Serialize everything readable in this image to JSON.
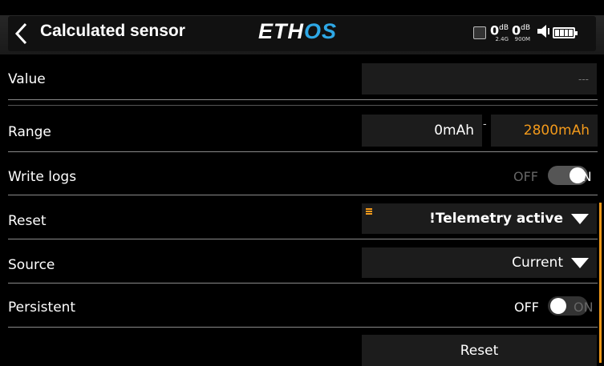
{
  "header": {
    "title": "Calculated sensor",
    "logo_main": "ETH",
    "logo_accent": "OS",
    "rssi_1": "0",
    "rssi_1_unit": "dB",
    "rssi_1_band": "2.4G",
    "rssi_2": "0",
    "rssi_2_unit": "dB",
    "rssi_2_band": "900M"
  },
  "rows": {
    "value": {
      "label": "Value",
      "current": "---"
    },
    "range": {
      "label": "Range",
      "min": "0mAh",
      "separator": "-",
      "max": "2800mAh"
    },
    "write_logs": {
      "label": "Write logs",
      "off": "OFF",
      "on": "ON",
      "state": "on"
    },
    "reset": {
      "label": "Reset",
      "selected": "!Telemetry active"
    },
    "source": {
      "label": "Source",
      "selected": "Current"
    },
    "persistent": {
      "label": "Persistent",
      "off": "OFF",
      "on": "ON",
      "state": "off"
    },
    "reset_button": "Reset"
  },
  "colors": {
    "accent": "#f39a1b",
    "logo_blue": "#2ea8e6"
  },
  "icons": [
    "back-icon",
    "sim-icon",
    "speaker-icon",
    "battery-icon",
    "menu-icon",
    "dropdown-arrow-icon"
  ]
}
